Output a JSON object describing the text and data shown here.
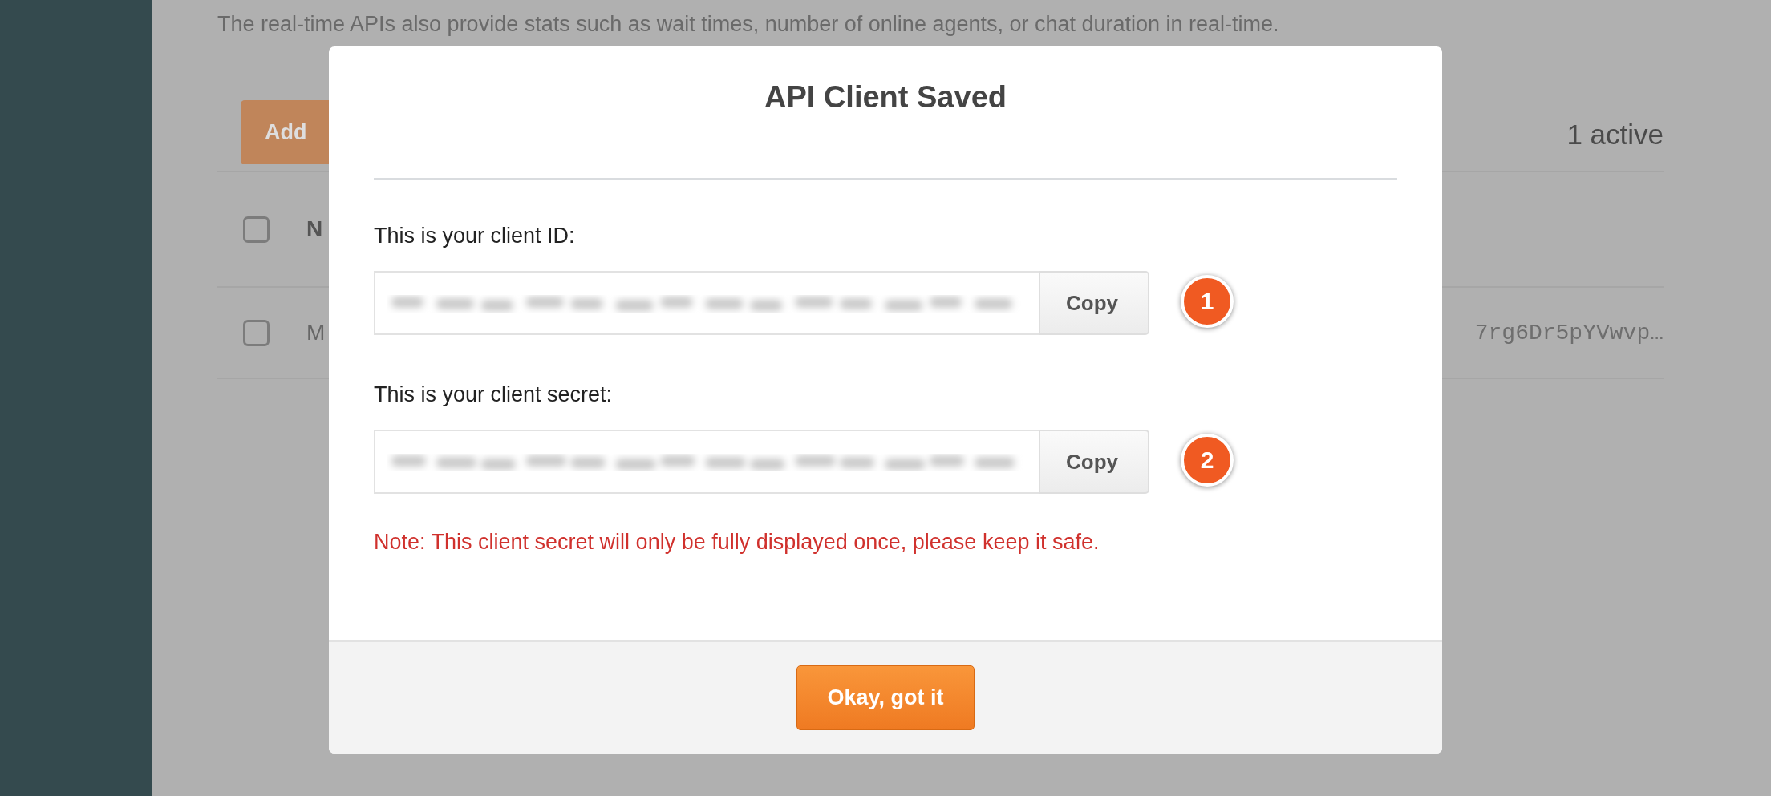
{
  "background": {
    "intro": "The real-time APIs also provide stats such as wait times, number of online agents, or chat duration in real-time.",
    "add_button": "Add",
    "active_count": "1 active",
    "table": {
      "header": {
        "checked": false,
        "column_1": "N"
      },
      "rows": [
        {
          "checked": false,
          "column_1": "M",
          "column_2": "7rg6Dr5pYVwvp…"
        }
      ]
    }
  },
  "dialog": {
    "title": "API Client Saved",
    "fields": [
      {
        "label": "This is your client ID:",
        "value_redacted": true,
        "copy_button": "Copy",
        "callout": "1"
      },
      {
        "label": "This is your client secret:",
        "value_redacted": true,
        "copy_button": "Copy",
        "callout": "2"
      }
    ],
    "note": "Note: This client secret will only be fully displayed once, please keep it safe.",
    "confirm_button": "Okay, got it"
  }
}
